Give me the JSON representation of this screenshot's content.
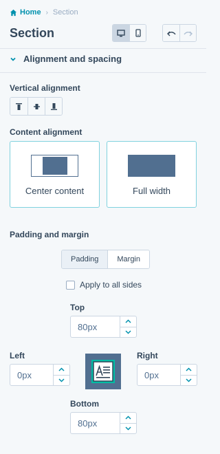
{
  "breadcrumb": {
    "home": "Home",
    "separator": "›",
    "current": "Section"
  },
  "header": {
    "title": "Section"
  },
  "device_toggle": {
    "icons": [
      "desktop-icon",
      "mobile-icon"
    ],
    "active": "desktop"
  },
  "history": {
    "icons": [
      "undo-icon",
      "redo-icon"
    ]
  },
  "accordion": {
    "label": "Alignment and spacing",
    "expanded": true
  },
  "vertical_alignment": {
    "label": "Vertical alignment",
    "options": [
      "align-top-icon",
      "align-middle-icon",
      "align-bottom-icon"
    ]
  },
  "content_alignment": {
    "label": "Content alignment",
    "options": [
      {
        "label": "Center content"
      },
      {
        "label": "Full width"
      }
    ]
  },
  "padding_margin": {
    "label": "Padding and margin",
    "tabs": [
      "Padding",
      "Margin"
    ],
    "active_tab": "Padding",
    "apply_all_label": "Apply to all sides",
    "apply_all_checked": false,
    "top": {
      "label": "Top",
      "value": "80px"
    },
    "left": {
      "label": "Left",
      "value": "0px"
    },
    "right": {
      "label": "Right",
      "value": "0px"
    },
    "bottom": {
      "label": "Bottom",
      "value": "80px"
    }
  },
  "colors": {
    "link": "#0091ae",
    "text": "#33475b",
    "accent_border": "#7fd1de",
    "preview_fill": "#516f90",
    "background": "#f5f8fa"
  }
}
